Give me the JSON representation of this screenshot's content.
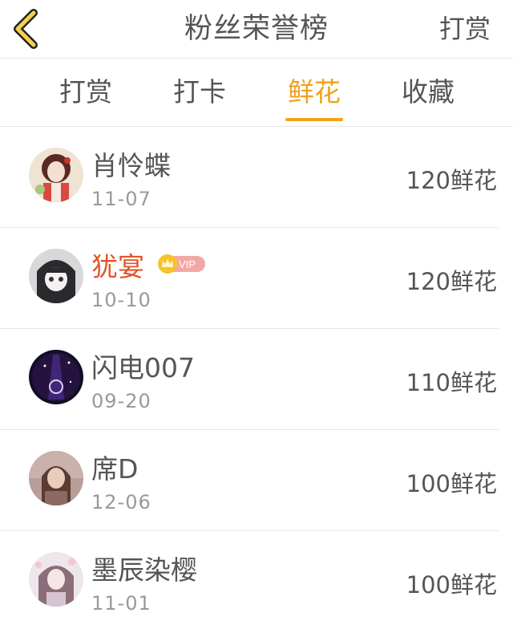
{
  "header": {
    "title": "粉丝荣誉榜",
    "action_label": "打赏"
  },
  "tabs": [
    {
      "label": "打赏",
      "active": false
    },
    {
      "label": "打卡",
      "active": false
    },
    {
      "label": "鲜花",
      "active": true
    },
    {
      "label": "收藏",
      "active": false
    }
  ],
  "colors": {
    "accent": "#f0a21b",
    "vip_name": "#e0552a",
    "vip_badge": "#f2a9a6",
    "crown": "#f5c42c"
  },
  "list": [
    {
      "name": "肖怜蝶",
      "date": "11-07",
      "amount": "120鲜花",
      "vip": false
    },
    {
      "name": "犹宴",
      "date": "10-10",
      "amount": "120鲜花",
      "vip": true,
      "badge": "VIP"
    },
    {
      "name": "闪电007",
      "date": "09-20",
      "amount": "110鲜花",
      "vip": false
    },
    {
      "name": "席D",
      "date": "12-06",
      "amount": "100鲜花",
      "vip": false
    },
    {
      "name": "墨辰染樱",
      "date": "11-01",
      "amount": "100鲜花",
      "vip": false
    }
  ]
}
